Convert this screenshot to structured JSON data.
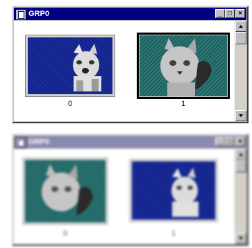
{
  "windows": [
    {
      "title": "GRP0",
      "buttons": {
        "minimize": "_",
        "maximize": "□",
        "close": "×"
      },
      "items": [
        {
          "caption": "0",
          "image": "dog",
          "background": "blue",
          "selected": false
        },
        {
          "caption": "1",
          "image": "cat",
          "background": "teal",
          "selected": true
        }
      ]
    },
    {
      "title": "GRP0",
      "buttons": {
        "minimize": "_",
        "maximize": "□",
        "close": "×"
      },
      "items": [
        {
          "caption": "0",
          "image": "cat",
          "background": "teal",
          "selected": false
        },
        {
          "caption": "1",
          "image": "dog",
          "background": "blue",
          "selected": false
        }
      ]
    }
  ],
  "colors": {
    "titlebar": "#000080",
    "blue_bg": "#1b2f9e",
    "teal_bg": "#2e7a78",
    "frame": "#c0c0c0"
  },
  "icons": [
    "app-icon",
    "minimize-icon",
    "maximize-icon",
    "close-icon",
    "scroll-up-icon",
    "scroll-down-icon"
  ]
}
